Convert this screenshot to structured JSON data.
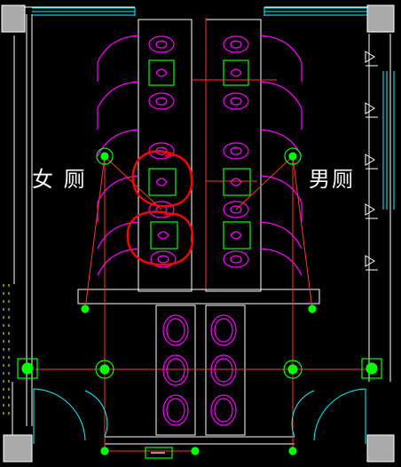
{
  "labels": {
    "women_toilet": "女 厕",
    "men_toilet": "男厕"
  },
  "colors": {
    "background": "#000000",
    "wall": "#ffffff",
    "partition": "#ff00ff",
    "fixture": "#ff00ff",
    "cistern": "#00ff00",
    "light": "#00ff00",
    "wire": "#ff3333",
    "markup": "#ff0000",
    "door": "#00ffff",
    "column": "#aaaaaa",
    "dashed": "#ffff00"
  }
}
